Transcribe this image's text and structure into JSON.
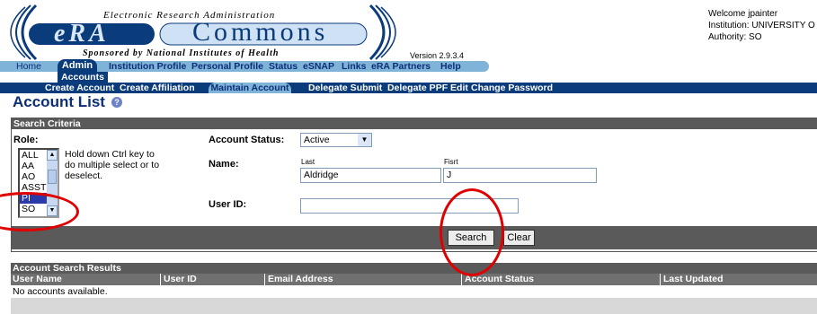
{
  "header": {
    "tagline": "Electronic Research Administration",
    "logo_era": "eRA",
    "logo_commons": "Commons",
    "sponsor": "Sponsored by National Institutes of Health",
    "version": "Version 2.9.3.4",
    "welcome": "Welcome jpainter",
    "institution": "Institution: UNIVERSITY O",
    "authority": "Authority:  SO"
  },
  "topnav": {
    "items": [
      "Home",
      "Admin",
      "Institution Profile",
      "Personal Profile",
      "Status",
      "eSNAP",
      "Links",
      "eRA Partners",
      "Help"
    ]
  },
  "subnav_level1": {
    "label": "Accounts"
  },
  "subnav_level2": {
    "items": [
      "Create Account",
      "Create Affiliation",
      "Maintain Account",
      "Delegate Submit",
      "Delegate PPF Edit",
      "Change Password"
    ],
    "active": "Maintain Account"
  },
  "page": {
    "title": "Account List",
    "help_icon": "?"
  },
  "search_criteria": {
    "title": "Search Criteria",
    "role_label": "Role:",
    "role_help": "Hold down Ctrl key to do multiple select or to deselect.",
    "roles": [
      "ALL",
      "AA",
      "AO",
      "ASST",
      "PI",
      "SO"
    ],
    "selected_role": "PI",
    "account_status_label": "Account Status:",
    "account_status_value": "Active",
    "name_label": "Name:",
    "last_label": "Last",
    "first_label": "Fisrt",
    "last_value": "Aldridge",
    "first_value": "J",
    "userid_label": "User ID:",
    "userid_value": "",
    "search_button": "Search",
    "clear_button": "Clear"
  },
  "results": {
    "title": "Account Search Results",
    "columns": [
      "User Name",
      "User ID",
      "Email Address",
      "Account Status",
      "Last Updated"
    ],
    "empty_message": "No accounts available."
  },
  "colors": {
    "nav_dark": "#0a3b7a",
    "nav_light": "#7fb3d8",
    "bar_gray": "#5a5a5a",
    "annotation_red": "#e00000"
  }
}
